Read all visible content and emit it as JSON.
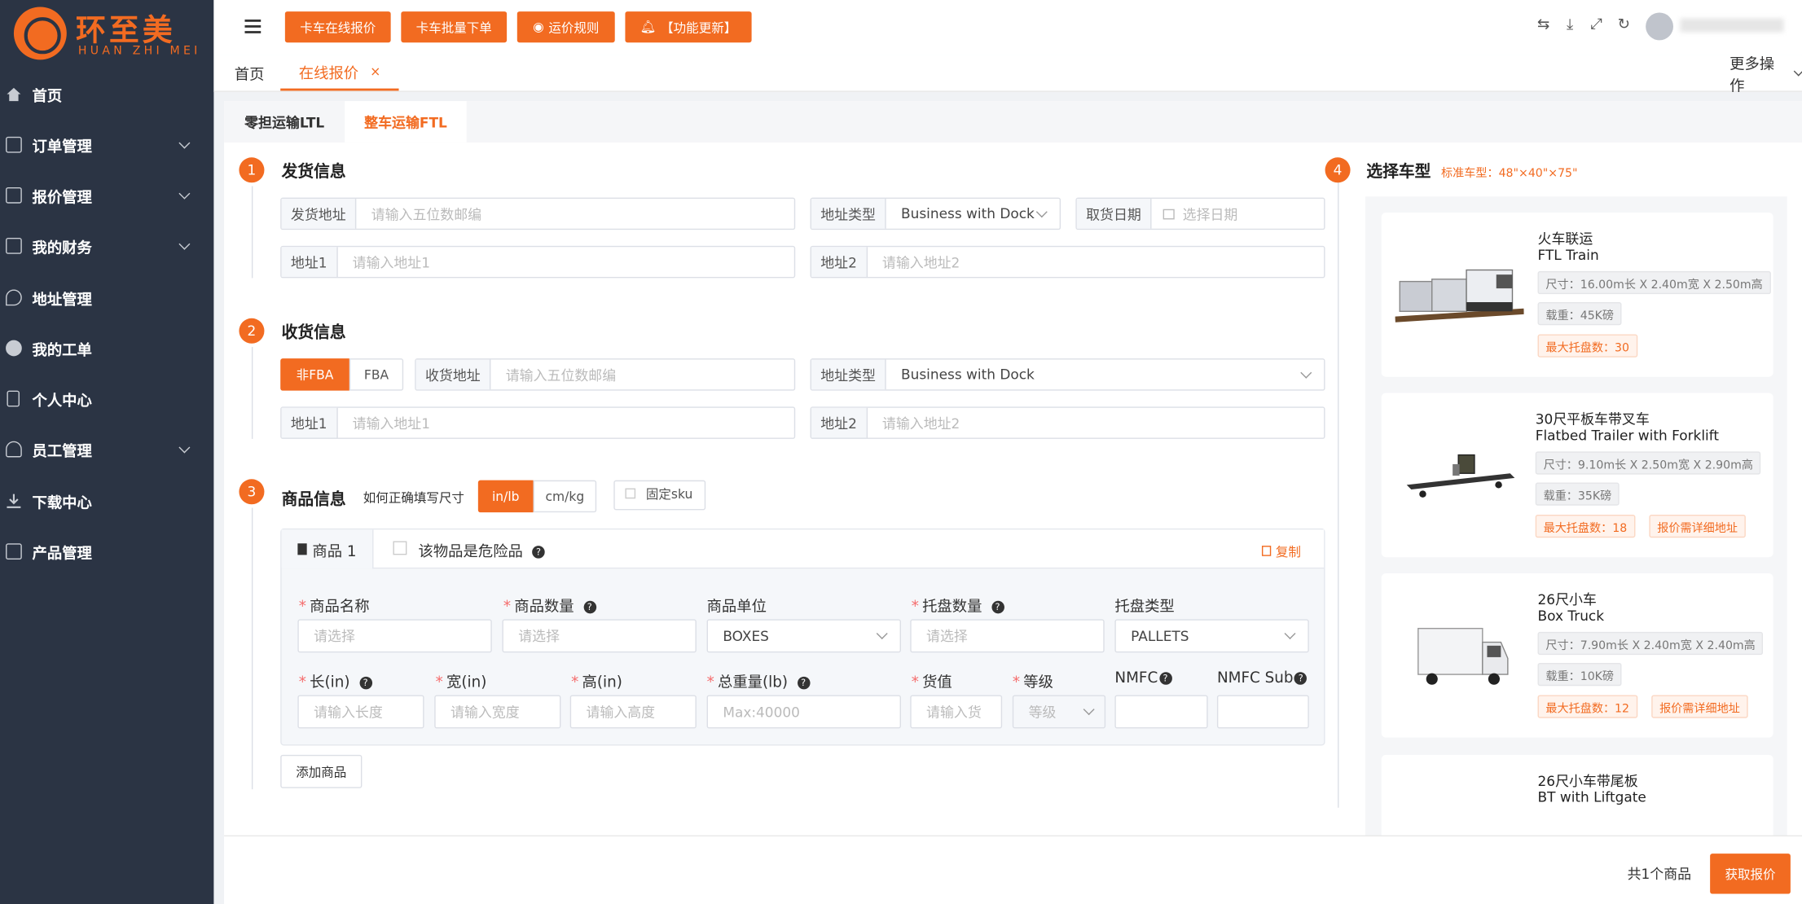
{
  "logo": {
    "cn": "环至美",
    "en": "HUAN ZHI MEI"
  },
  "sidebar": {
    "items": [
      {
        "label": "首页",
        "arrow": false
      },
      {
        "label": "订单管理",
        "arrow": true
      },
      {
        "label": "报价管理",
        "arrow": true
      },
      {
        "label": "我的财务",
        "arrow": true
      },
      {
        "label": "地址管理",
        "arrow": false
      },
      {
        "label": "我的工单",
        "arrow": false
      },
      {
        "label": "个人中心",
        "arrow": false
      },
      {
        "label": "员工管理",
        "arrow": true
      },
      {
        "label": "下载中心",
        "arrow": false
      },
      {
        "label": "产品管理",
        "arrow": false
      }
    ]
  },
  "header": {
    "buttons": [
      "卡车在线报价",
      "卡车批量下单",
      "运价规则",
      "【功能更新】"
    ]
  },
  "tagsbar": {
    "home": "首页",
    "active": "在线报价",
    "more": "更多操作"
  },
  "tabs": {
    "ltl": "零担运输LTL",
    "ftl": "整车运输FTL"
  },
  "section1": {
    "step": "1",
    "title": "发货信息",
    "addr_label": "发货地址",
    "addr_placeholder": "请输入五位数邮编",
    "type_label": "地址类型",
    "type_value": "Business with Dock",
    "date_label": "取货日期",
    "date_placeholder": "选择日期",
    "a1_label": "地址1",
    "a1_placeholder": "请输入地址1",
    "a2_label": "地址2",
    "a2_placeholder": "请输入地址2"
  },
  "section2": {
    "step": "2",
    "title": "收货信息",
    "seg_nonfba": "非FBA",
    "seg_fba": "FBA",
    "addr_label": "收货地址",
    "addr_placeholder": "请输入五位数邮编",
    "type_label": "地址类型",
    "type_value": "Business with Dock",
    "a1_label": "地址1",
    "a1_placeholder": "请输入地址1",
    "a2_label": "地址2",
    "a2_placeholder": "请输入地址2"
  },
  "section3": {
    "step": "3",
    "title": "商品信息",
    "hint": "如何正确填写尺寸",
    "unit_in": "in/lb",
    "unit_cm": "cm/kg",
    "fixed_sku": "固定sku",
    "goods_tab": "商品 1",
    "danger": "该物品是危险品",
    "copy": "复制",
    "labels": {
      "name": "商品名称",
      "qty": "商品数量",
      "unit": "商品单位",
      "pallet_qty": "托盘数量",
      "pallet_type": "托盘类型",
      "len": "长(in)",
      "wid": "宽(in)",
      "hei": "高(in)",
      "weight": "总重量(lb)",
      "value": "货值",
      "grade": "等级",
      "nmfc": "NMFC",
      "nmfc_sub": "NMFC Sub"
    },
    "inputs": {
      "name": "请选择",
      "qty": "请选择",
      "unit": "BOXES",
      "pallet_qty": "请选择",
      "pallet_type": "PALLETS",
      "len": "请输入长度",
      "wid": "请输入宽度",
      "hei": "请输入高度",
      "weight": "Max:40000",
      "value": "请输入货",
      "grade": "等级"
    },
    "add_goods": "添加商品"
  },
  "section4": {
    "step": "4",
    "title": "选择车型",
    "subtitle": "标准车型：48\"×40\"×75\""
  },
  "vehicles": [
    {
      "cn": "火车联运",
      "en": "FTL Train",
      "size": "尺寸：16.00m长 X 2.40m宽 X 2.50m高",
      "load": "载重：45K磅",
      "pallets": "最大托盘数：30",
      "extra": ""
    },
    {
      "cn": "30尺平板车带叉车",
      "en": "Flatbed Trailer with Forklift",
      "size": "尺寸：9.10m长 X 2.50m宽 X 2.90m高",
      "load": "载重：35K磅",
      "pallets": "最大托盘数：18",
      "extra": "报价需详细地址"
    },
    {
      "cn": "26尺小车",
      "en": "Box Truck",
      "size": "尺寸：7.90m长 X 2.40m宽 X 2.40m高",
      "load": "载重：10K磅",
      "pallets": "最大托盘数：12",
      "extra": "报价需详细地址"
    },
    {
      "cn": "26尺小车带尾板",
      "en": "BT with Liftgate"
    }
  ],
  "footer": {
    "count": "共1个商品",
    "submit": "获取报价"
  },
  "colors": {
    "accent": "#f26b21",
    "sidebar": "#2b3444"
  }
}
